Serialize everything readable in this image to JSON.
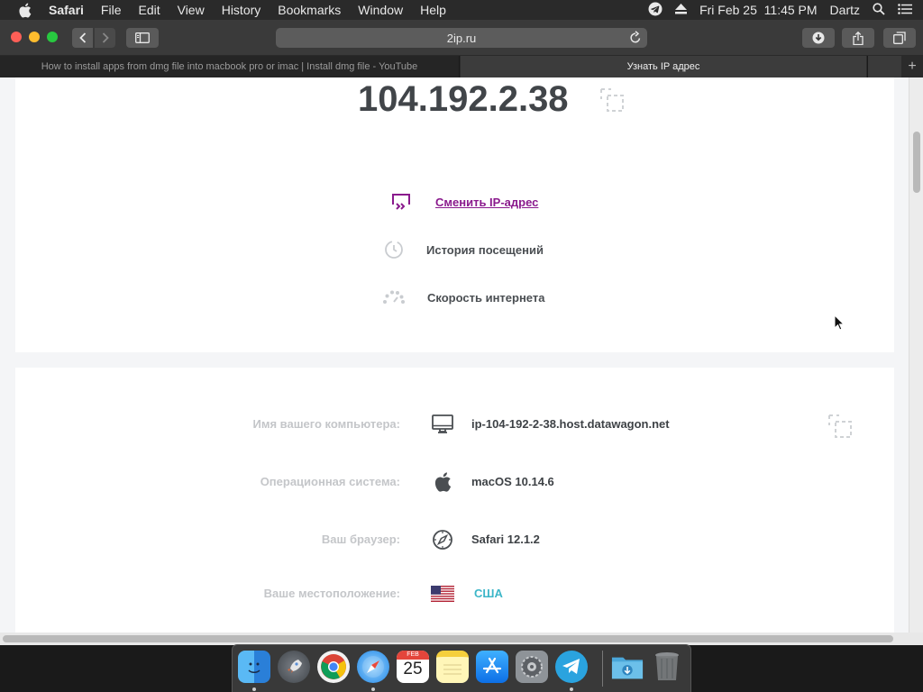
{
  "menubar": {
    "app_name": "Safari",
    "items": [
      "File",
      "Edit",
      "View",
      "History",
      "Bookmarks",
      "Window",
      "Help"
    ],
    "clock": "Fri Feb 25  11:45 PM",
    "user": "Dartz"
  },
  "toolbar": {
    "url": "2ip.ru"
  },
  "tabs": [
    {
      "title": "How to install apps from dmg file into macbook pro or imac | Install dmg file - YouTube",
      "active": false
    },
    {
      "title": "Узнать IP адрес",
      "active": true
    }
  ],
  "newtab_label": "+",
  "page": {
    "ip": "104.192.2.38",
    "links": {
      "change_ip": "Сменить IP-адрес",
      "history": "История посещений",
      "speed": "Скорость интернета"
    },
    "info": [
      {
        "label": "Имя вашего компьютера:",
        "value": "ip-104-192-2-38.host.datawagon.net",
        "icon": "monitor-icon"
      },
      {
        "label": "Операционная система:",
        "value": "macOS 10.14.6",
        "icon": "apple-icon"
      },
      {
        "label": "Ваш браузер:",
        "value": "Safari 12.1.2",
        "icon": "compass-icon"
      },
      {
        "label": "Ваше местоположение:",
        "value": "США",
        "icon": "us-flag-icon"
      }
    ]
  },
  "dock": {
    "apps": [
      "Finder",
      "Launchpad",
      "Chrome",
      "Safari",
      "Calendar",
      "Notes",
      "App Store",
      "System Preferences",
      "Telegram",
      "Downloads",
      "Trash"
    ],
    "calendar_month": "FEB",
    "calendar_day": "25"
  },
  "colors": {
    "accent_purple": "#8a1a8d",
    "link_teal": "#3cb6c8",
    "ip_text": "#414549"
  }
}
